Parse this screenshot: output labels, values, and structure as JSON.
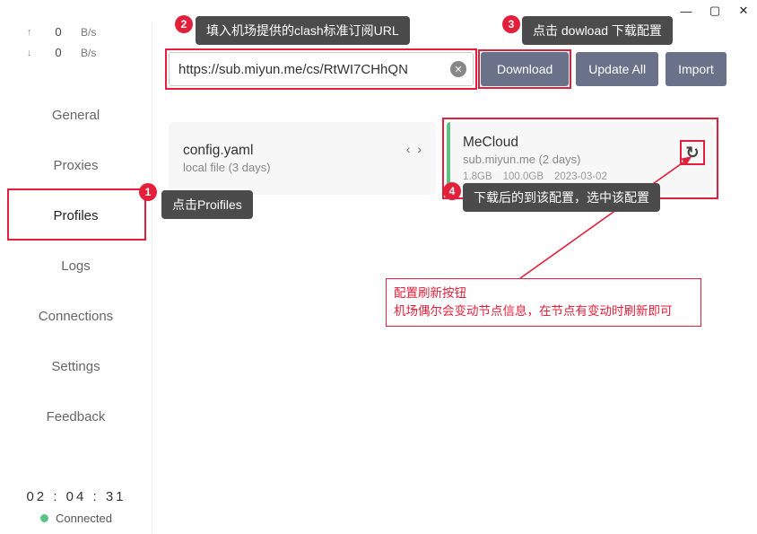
{
  "titlebar": {
    "min": "—",
    "max": "▢",
    "close": "✕"
  },
  "speed": {
    "up": {
      "arrow": "↑",
      "value": "0",
      "unit": "B/s"
    },
    "down": {
      "arrow": "↓",
      "value": "0",
      "unit": "B/s"
    }
  },
  "nav": {
    "general": "General",
    "proxies": "Proxies",
    "profiles": "Profiles",
    "logs": "Logs",
    "connections": "Connections",
    "settings": "Settings",
    "feedback": "Feedback"
  },
  "status": {
    "clock": "02 : 04 : 31",
    "state": "Connected"
  },
  "url": {
    "value": "https://sub.miyun.me/cs/RtWI7CHhQN"
  },
  "buttons": {
    "download": "Download",
    "update_all": "Update All",
    "import": "Import"
  },
  "cards": {
    "local": {
      "title": "config.yaml",
      "sub": "local file (3 days)"
    },
    "remote": {
      "title": "MeCloud",
      "sub": "sub.miyun.me (2 days)",
      "used": "1.8GB",
      "total": "100.0GB",
      "date": "2023-03-02"
    }
  },
  "annotations": {
    "a1": "点击Proifiles",
    "a2": "填入机场提供的clash标准订阅URL",
    "a3": "点击 dowload 下载配置",
    "a4": "下载后的到该配置，选中该配置",
    "note1": "配置刷新按钮",
    "note2": "机场偶尔会变动节点信息，在节点有变动时刷新即可"
  },
  "icons": {
    "clear": "✕",
    "drag": "‹ ›",
    "refresh": "↻"
  }
}
